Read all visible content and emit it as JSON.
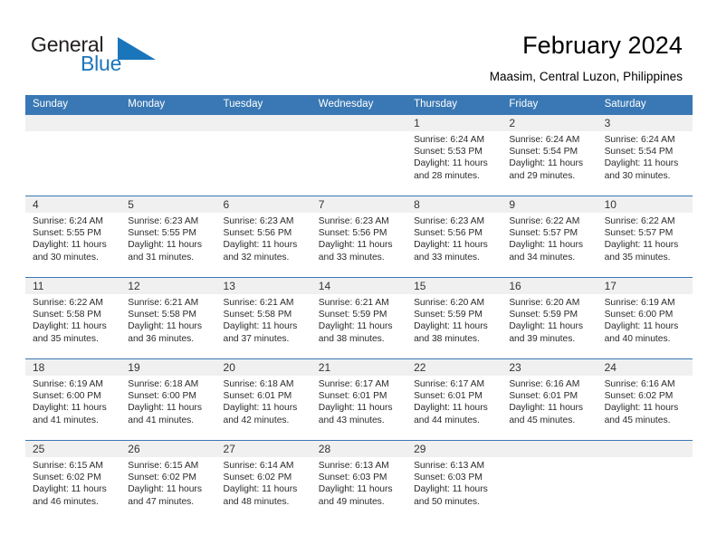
{
  "brand": {
    "name_dark": "General",
    "name_blue": "Blue",
    "triangle_color": "#1b75bb",
    "blue": "#1b75bb"
  },
  "header": {
    "title": "February 2024",
    "subtitle": "Maasim, Central Luzon, Philippines"
  },
  "theme": {
    "header_bar": "#3978b4",
    "day_band": "#f0f0f0",
    "text": "#2b2b2b"
  },
  "weekdays": [
    "Sunday",
    "Monday",
    "Tuesday",
    "Wednesday",
    "Thursday",
    "Friday",
    "Saturday"
  ],
  "labels": {
    "sunrise": "Sunrise:",
    "sunset": "Sunset:",
    "daylight": "Daylight:"
  },
  "weeks": [
    [
      {
        "empty": true
      },
      {
        "empty": true
      },
      {
        "empty": true
      },
      {
        "empty": true
      },
      {
        "day": "1",
        "sunrise": "Sunrise: 6:24 AM",
        "sunset": "Sunset: 5:53 PM",
        "daylight1": "Daylight: 11 hours",
        "daylight2": "and 28 minutes."
      },
      {
        "day": "2",
        "sunrise": "Sunrise: 6:24 AM",
        "sunset": "Sunset: 5:54 PM",
        "daylight1": "Daylight: 11 hours",
        "daylight2": "and 29 minutes."
      },
      {
        "day": "3",
        "sunrise": "Sunrise: 6:24 AM",
        "sunset": "Sunset: 5:54 PM",
        "daylight1": "Daylight: 11 hours",
        "daylight2": "and 30 minutes."
      }
    ],
    [
      {
        "day": "4",
        "sunrise": "Sunrise: 6:24 AM",
        "sunset": "Sunset: 5:55 PM",
        "daylight1": "Daylight: 11 hours",
        "daylight2": "and 30 minutes."
      },
      {
        "day": "5",
        "sunrise": "Sunrise: 6:23 AM",
        "sunset": "Sunset: 5:55 PM",
        "daylight1": "Daylight: 11 hours",
        "daylight2": "and 31 minutes."
      },
      {
        "day": "6",
        "sunrise": "Sunrise: 6:23 AM",
        "sunset": "Sunset: 5:56 PM",
        "daylight1": "Daylight: 11 hours",
        "daylight2": "and 32 minutes."
      },
      {
        "day": "7",
        "sunrise": "Sunrise: 6:23 AM",
        "sunset": "Sunset: 5:56 PM",
        "daylight1": "Daylight: 11 hours",
        "daylight2": "and 33 minutes."
      },
      {
        "day": "8",
        "sunrise": "Sunrise: 6:23 AM",
        "sunset": "Sunset: 5:56 PM",
        "daylight1": "Daylight: 11 hours",
        "daylight2": "and 33 minutes."
      },
      {
        "day": "9",
        "sunrise": "Sunrise: 6:22 AM",
        "sunset": "Sunset: 5:57 PM",
        "daylight1": "Daylight: 11 hours",
        "daylight2": "and 34 minutes."
      },
      {
        "day": "10",
        "sunrise": "Sunrise: 6:22 AM",
        "sunset": "Sunset: 5:57 PM",
        "daylight1": "Daylight: 11 hours",
        "daylight2": "and 35 minutes."
      }
    ],
    [
      {
        "day": "11",
        "sunrise": "Sunrise: 6:22 AM",
        "sunset": "Sunset: 5:58 PM",
        "daylight1": "Daylight: 11 hours",
        "daylight2": "and 35 minutes."
      },
      {
        "day": "12",
        "sunrise": "Sunrise: 6:21 AM",
        "sunset": "Sunset: 5:58 PM",
        "daylight1": "Daylight: 11 hours",
        "daylight2": "and 36 minutes."
      },
      {
        "day": "13",
        "sunrise": "Sunrise: 6:21 AM",
        "sunset": "Sunset: 5:58 PM",
        "daylight1": "Daylight: 11 hours",
        "daylight2": "and 37 minutes."
      },
      {
        "day": "14",
        "sunrise": "Sunrise: 6:21 AM",
        "sunset": "Sunset: 5:59 PM",
        "daylight1": "Daylight: 11 hours",
        "daylight2": "and 38 minutes."
      },
      {
        "day": "15",
        "sunrise": "Sunrise: 6:20 AM",
        "sunset": "Sunset: 5:59 PM",
        "daylight1": "Daylight: 11 hours",
        "daylight2": "and 38 minutes."
      },
      {
        "day": "16",
        "sunrise": "Sunrise: 6:20 AM",
        "sunset": "Sunset: 5:59 PM",
        "daylight1": "Daylight: 11 hours",
        "daylight2": "and 39 minutes."
      },
      {
        "day": "17",
        "sunrise": "Sunrise: 6:19 AM",
        "sunset": "Sunset: 6:00 PM",
        "daylight1": "Daylight: 11 hours",
        "daylight2": "and 40 minutes."
      }
    ],
    [
      {
        "day": "18",
        "sunrise": "Sunrise: 6:19 AM",
        "sunset": "Sunset: 6:00 PM",
        "daylight1": "Daylight: 11 hours",
        "daylight2": "and 41 minutes."
      },
      {
        "day": "19",
        "sunrise": "Sunrise: 6:18 AM",
        "sunset": "Sunset: 6:00 PM",
        "daylight1": "Daylight: 11 hours",
        "daylight2": "and 41 minutes."
      },
      {
        "day": "20",
        "sunrise": "Sunrise: 6:18 AM",
        "sunset": "Sunset: 6:01 PM",
        "daylight1": "Daylight: 11 hours",
        "daylight2": "and 42 minutes."
      },
      {
        "day": "21",
        "sunrise": "Sunrise: 6:17 AM",
        "sunset": "Sunset: 6:01 PM",
        "daylight1": "Daylight: 11 hours",
        "daylight2": "and 43 minutes."
      },
      {
        "day": "22",
        "sunrise": "Sunrise: 6:17 AM",
        "sunset": "Sunset: 6:01 PM",
        "daylight1": "Daylight: 11 hours",
        "daylight2": "and 44 minutes."
      },
      {
        "day": "23",
        "sunrise": "Sunrise: 6:16 AM",
        "sunset": "Sunset: 6:01 PM",
        "daylight1": "Daylight: 11 hours",
        "daylight2": "and 45 minutes."
      },
      {
        "day": "24",
        "sunrise": "Sunrise: 6:16 AM",
        "sunset": "Sunset: 6:02 PM",
        "daylight1": "Daylight: 11 hours",
        "daylight2": "and 45 minutes."
      }
    ],
    [
      {
        "day": "25",
        "sunrise": "Sunrise: 6:15 AM",
        "sunset": "Sunset: 6:02 PM",
        "daylight1": "Daylight: 11 hours",
        "daylight2": "and 46 minutes."
      },
      {
        "day": "26",
        "sunrise": "Sunrise: 6:15 AM",
        "sunset": "Sunset: 6:02 PM",
        "daylight1": "Daylight: 11 hours",
        "daylight2": "and 47 minutes."
      },
      {
        "day": "27",
        "sunrise": "Sunrise: 6:14 AM",
        "sunset": "Sunset: 6:02 PM",
        "daylight1": "Daylight: 11 hours",
        "daylight2": "and 48 minutes."
      },
      {
        "day": "28",
        "sunrise": "Sunrise: 6:13 AM",
        "sunset": "Sunset: 6:03 PM",
        "daylight1": "Daylight: 11 hours",
        "daylight2": "and 49 minutes."
      },
      {
        "day": "29",
        "sunrise": "Sunrise: 6:13 AM",
        "sunset": "Sunset: 6:03 PM",
        "daylight1": "Daylight: 11 hours",
        "daylight2": "and 50 minutes."
      },
      {
        "empty": true
      },
      {
        "empty": true
      }
    ]
  ]
}
